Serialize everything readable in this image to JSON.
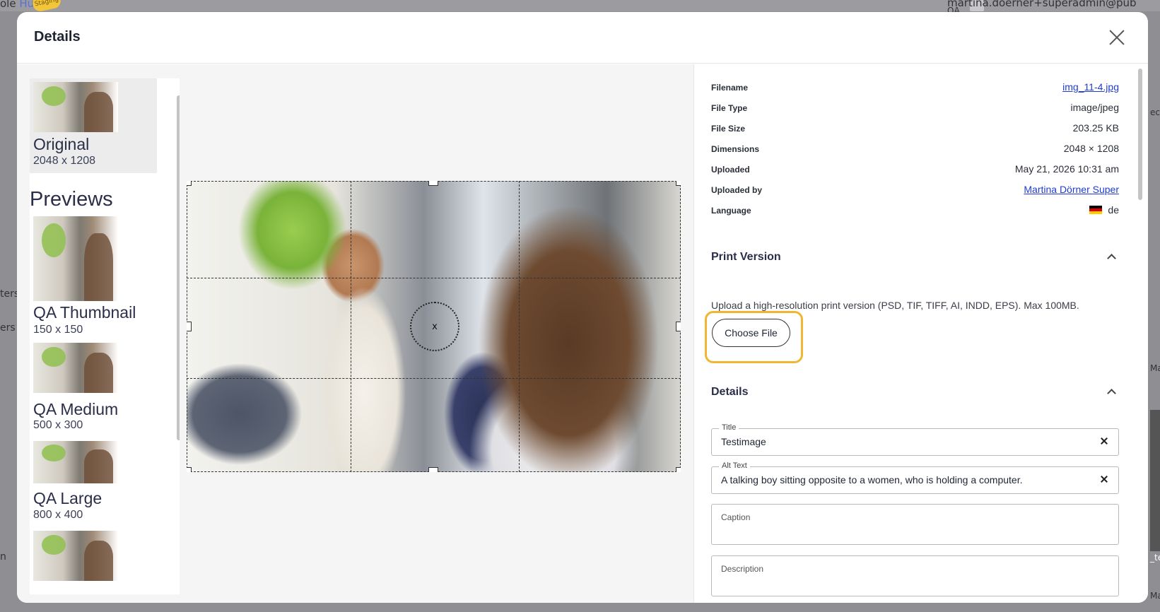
{
  "background": {
    "brand_prefix": "ole",
    "brand_suffix": "Hub",
    "badge": "Staging",
    "user": "martina.doerner+superadmin@pub",
    "user_sub": "QA",
    "left_texts": [
      "ters",
      "ers",
      "n"
    ],
    "right_texts": [
      "ecti",
      "Ma",
      "_te",
      "Ma"
    ]
  },
  "modal": {
    "title": "Details",
    "close_label": "Close"
  },
  "previews": {
    "original": {
      "name": "Original",
      "dim": "2048 x 1208"
    },
    "heading": "Previews",
    "items": [
      {
        "name": "QA Thumbnail",
        "dim": "150 x 150"
      },
      {
        "name": "QA Medium",
        "dim": "500 x 300"
      },
      {
        "name": "QA Large",
        "dim": "800 x 400"
      }
    ]
  },
  "crop": {
    "focal_marker": "x"
  },
  "file_info": {
    "filename_label": "Filename",
    "filename": "img_11-4.jpg",
    "filetype_label": "File Type",
    "filetype": "image/jpeg",
    "filesize_label": "File Size",
    "filesize": "203.25 KB",
    "dimensions_label": "Dimensions",
    "dimensions": "2048 × 1208",
    "uploaded_label": "Uploaded",
    "uploaded": "May 21, 2026 10:31 am",
    "uploaded_by_label": "Uploaded by",
    "uploaded_by": "Martina Dörner Super",
    "language_label": "Language",
    "language": "de"
  },
  "print_version": {
    "title": "Print Version",
    "note": "Upload a high-resolution print version (PSD, TIF, TIFF, AI, INDD, EPS). Max 100MB.",
    "choose_file": "Choose File"
  },
  "details": {
    "title": "Details",
    "title_label": "Title",
    "title_value": "Testimage",
    "alt_label": "Alt Text",
    "alt_value": "A talking boy sitting opposite to a women, who is holding a computer.",
    "caption_label": "Caption",
    "description_label": "Description"
  }
}
